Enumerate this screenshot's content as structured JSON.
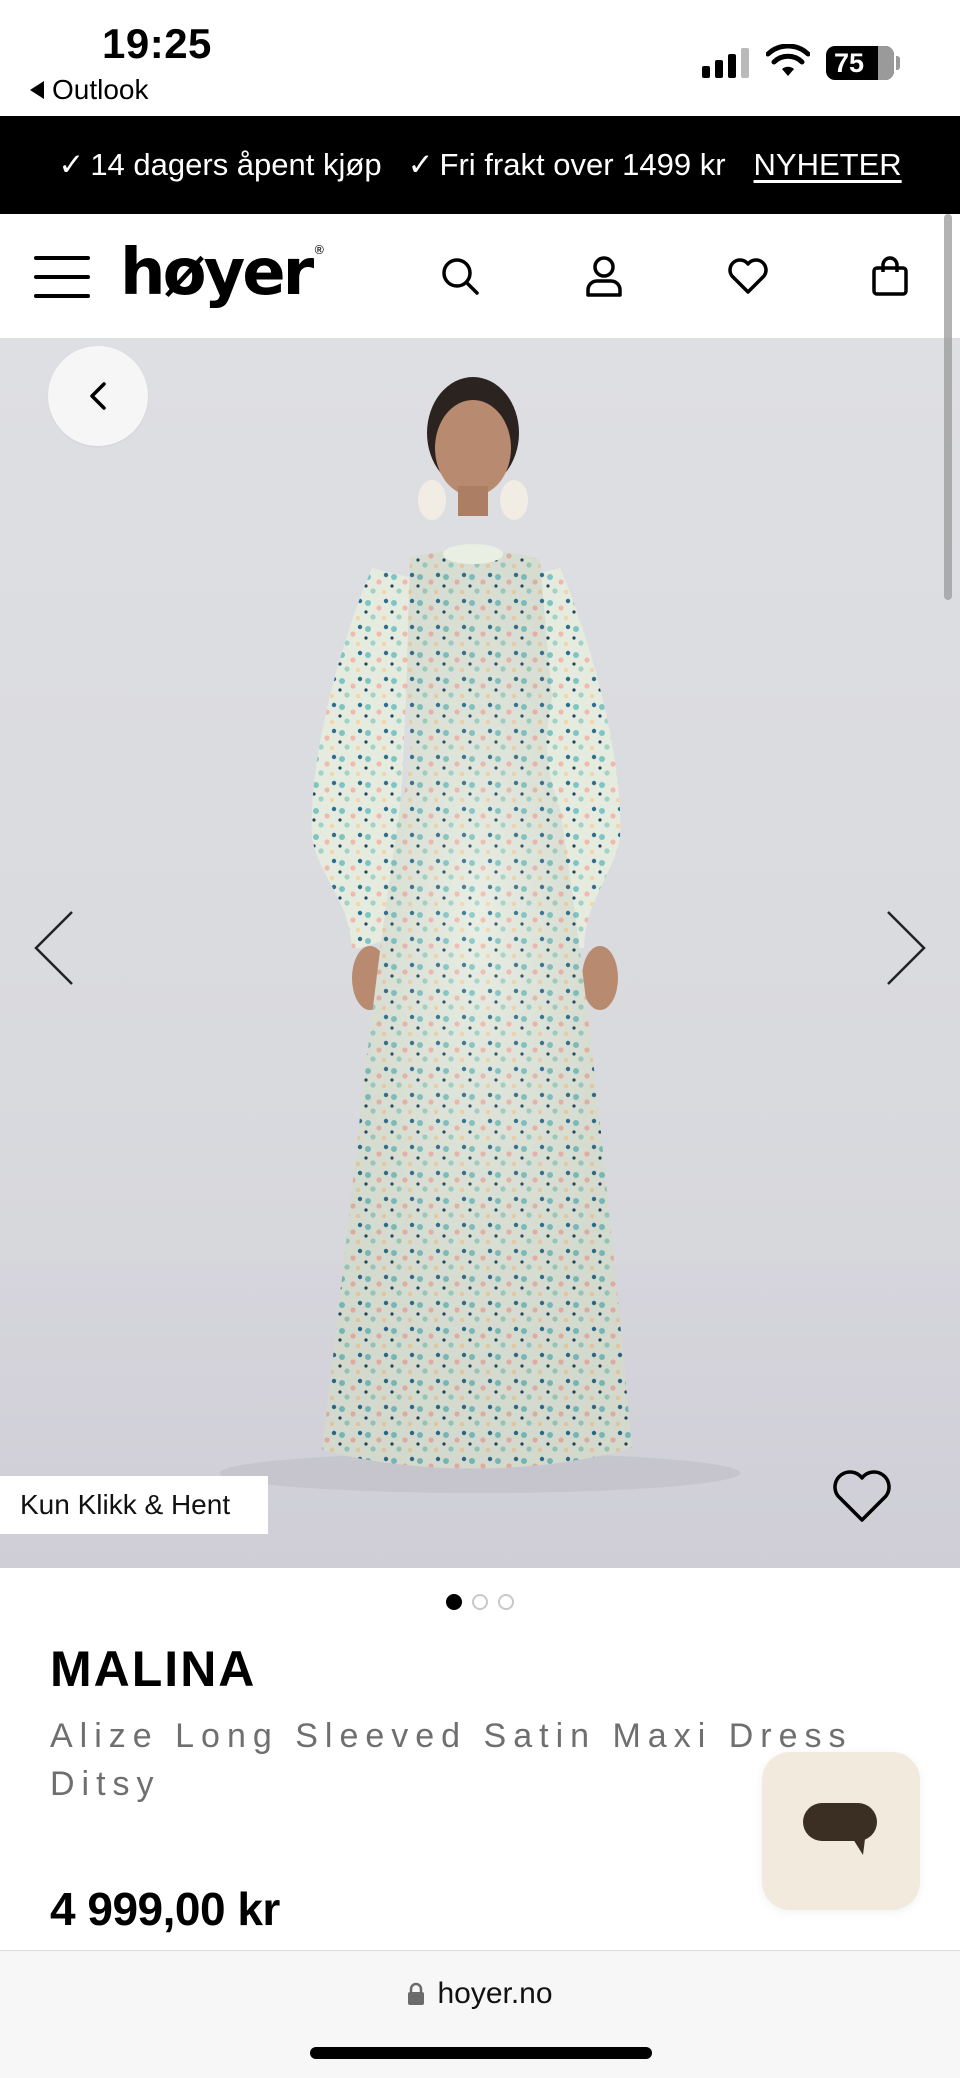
{
  "status_bar": {
    "time": "19:25",
    "back_app": "Outlook",
    "battery": "75"
  },
  "promo": {
    "item1": "14 dagers åpent kjøp",
    "item2": "Fri frakt over 1499 kr",
    "link": "NYHETER",
    "check_glyph": "✓"
  },
  "header": {
    "logo": "høyer",
    "logo_mark": "®"
  },
  "gallery": {
    "badge": "Kun Klikk & Hent",
    "image_count": 3,
    "active_index": 0
  },
  "product": {
    "brand": "MALINA",
    "name": "Alize Long Sleeved Satin Maxi Dress Ditsy",
    "price": "4 999,00 kr"
  },
  "browser": {
    "url": "hoyer.no"
  },
  "icons": {
    "menu": "hamburger-menu-icon",
    "search": "search-icon",
    "account": "user-icon",
    "wishlist": "heart-icon",
    "cart": "shopping-bag-icon",
    "chat": "chat-bubble-icon",
    "lock": "lock-icon"
  },
  "colors": {
    "promo_bg": "#000000",
    "image_bg": "#dcdde1",
    "chat_bg": "#f2eadd",
    "chat_icon": "#3b2f24",
    "subtitle_text": "#6f6f6f"
  }
}
